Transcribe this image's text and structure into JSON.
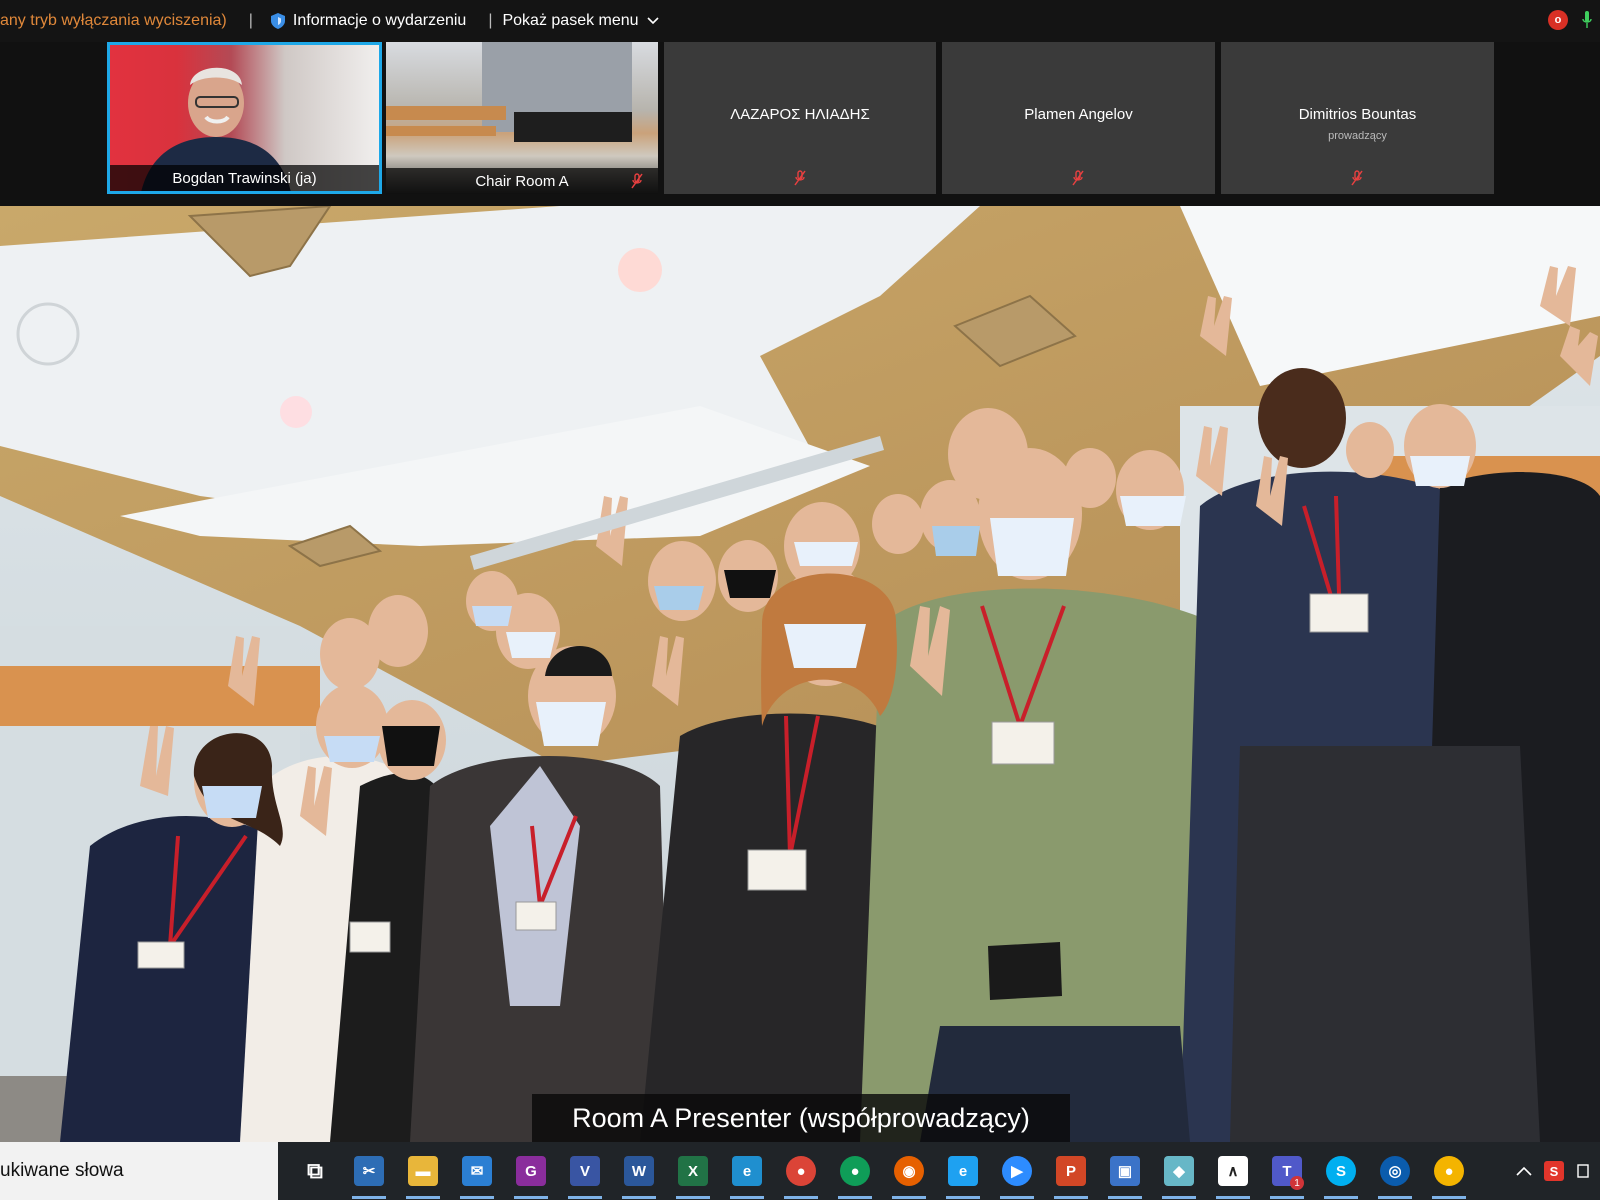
{
  "topbar": {
    "notice": "any tryb wyłączania wyciszenia)",
    "event_info": "Informacje o wydarzeniu",
    "show_menu": "Pokaż pasek menu",
    "rec_badge": "o"
  },
  "participants": [
    {
      "name": "Bogdan Trawinski  (ja)",
      "sub": ""
    },
    {
      "name": "Chair Room A",
      "sub": ""
    },
    {
      "name": "ΛΑΖΑΡΟΣ ΗΛΙΑΔΗΣ",
      "sub": ""
    },
    {
      "name": "Plamen Angelov",
      "sub": ""
    },
    {
      "name": "Dimitrios Bountas",
      "sub": "prowadzący"
    }
  ],
  "video": {
    "caption": "Room A Presenter (współprowadzący)"
  },
  "taskbar": {
    "search_text": "ukiwane słowa",
    "apps": [
      {
        "icon": "task-view-icon",
        "glyph": "⧉",
        "color": "#202428"
      },
      {
        "icon": "snipping-tool-icon",
        "glyph": "✂",
        "color": "#2d6db5"
      },
      {
        "icon": "file-explorer-icon",
        "glyph": "▬",
        "color": "#e8b63a"
      },
      {
        "icon": "mail-icon",
        "glyph": "✉",
        "color": "#2b7fd3"
      },
      {
        "icon": "pdf-editor-icon",
        "glyph": "G",
        "color": "#8a2d9c"
      },
      {
        "icon": "visio-icon",
        "glyph": "V",
        "color": "#3955a3"
      },
      {
        "icon": "word-icon",
        "glyph": "W",
        "color": "#2b579a"
      },
      {
        "icon": "excel-icon",
        "glyph": "X",
        "color": "#217346"
      },
      {
        "icon": "edge-icon",
        "glyph": "e",
        "color": "#1f8fcf"
      },
      {
        "icon": "chrome-icon",
        "glyph": "●",
        "color": "#db4437"
      },
      {
        "icon": "chrome-profile-icon",
        "glyph": "●",
        "color": "#0f9d58"
      },
      {
        "icon": "firefox-icon",
        "glyph": "◉",
        "color": "#e66000"
      },
      {
        "icon": "internet-explorer-icon",
        "glyph": "e",
        "color": "#1ea1f1"
      },
      {
        "icon": "zoom-icon",
        "glyph": "▶",
        "color": "#2d8cff"
      },
      {
        "icon": "powerpoint-icon",
        "glyph": "P",
        "color": "#d24726"
      },
      {
        "icon": "save-disk-icon",
        "glyph": "▣",
        "color": "#3b73c8"
      },
      {
        "icon": "eraser-icon",
        "glyph": "◆",
        "color": "#67b7c7"
      },
      {
        "icon": "plot-app-icon",
        "glyph": "∧",
        "color": "#ffffff"
      },
      {
        "icon": "teams-icon",
        "glyph": "T",
        "color": "#5059c9"
      },
      {
        "icon": "skype-icon",
        "glyph": "S",
        "color": "#00aff0"
      },
      {
        "icon": "meeting-app-icon",
        "glyph": "◎",
        "color": "#0b5cad"
      },
      {
        "icon": "chrome-icon-2",
        "glyph": "●",
        "color": "#f4b400"
      }
    ],
    "teams_badge": "1"
  }
}
